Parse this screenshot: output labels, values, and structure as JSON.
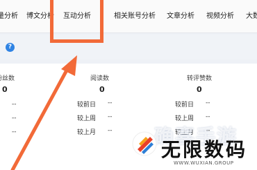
{
  "tabs": [
    {
      "label": "流量分析"
    },
    {
      "label": "博文分析"
    },
    {
      "label": "互动分析"
    },
    {
      "label": "相关账号分析"
    },
    {
      "label": "文章分析"
    },
    {
      "label": "视频分析"
    },
    {
      "label": "大数据"
    }
  ],
  "columns": [
    {
      "title": "粉丝数",
      "total": "0"
    },
    {
      "title": "阅读数",
      "total": "0"
    },
    {
      "title": "转评赞数",
      "total": "0"
    }
  ],
  "rows": [
    "较前日",
    "较上周",
    "较上月"
  ],
  "empty_value": "--",
  "help_icon": "?",
  "watermark": {
    "top": "确喜手游",
    "main": "无限数码",
    "url": "WWW.WUXIAN.GROUP"
  },
  "colors": {
    "highlight": "#f26a38",
    "accent": "#2f83e3"
  }
}
